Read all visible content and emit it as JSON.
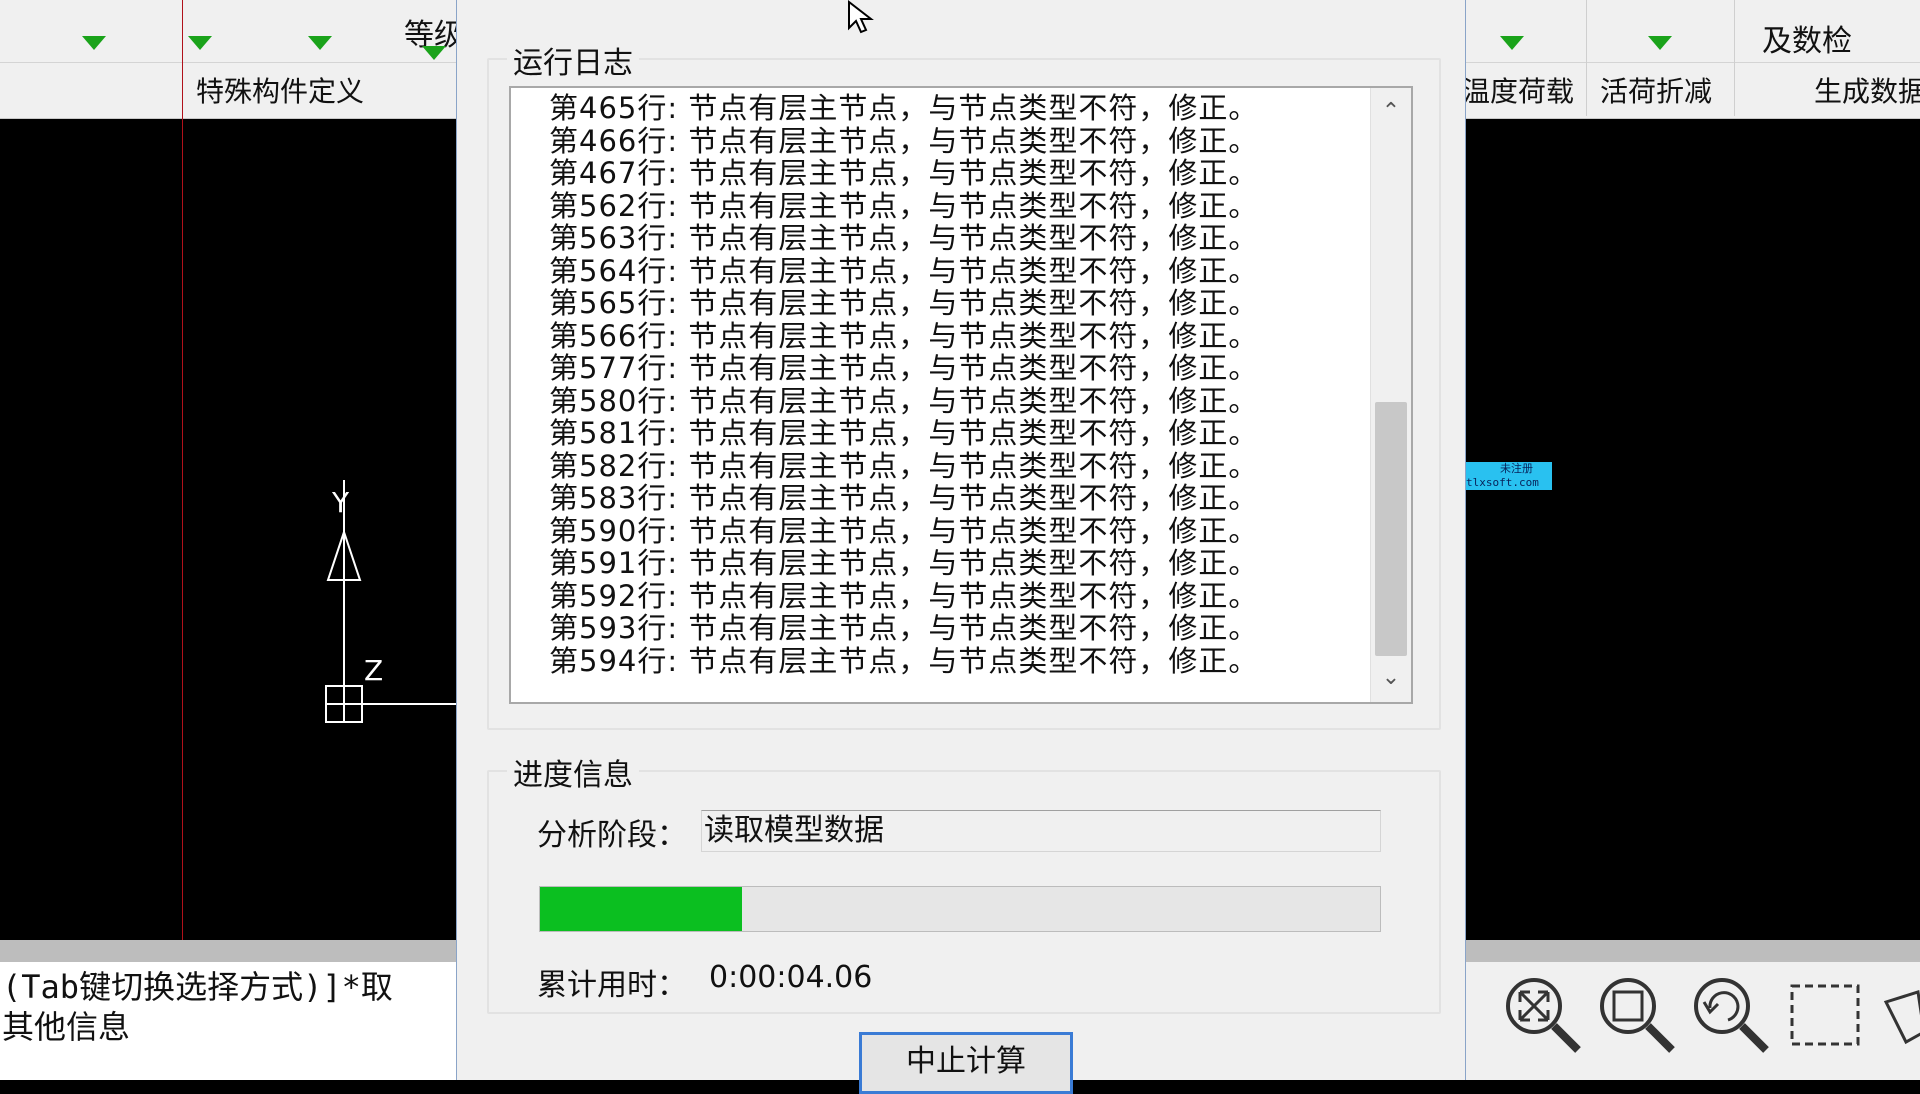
{
  "ribbon": {
    "left_button_partial": "等级",
    "left_group_label": "特殊构件定义",
    "right_group_label_1": "温度荷载",
    "right_group_label_2": "活荷折减",
    "right_button_top": "及数检",
    "right_group_label_3": "生成数据"
  },
  "dialog": {
    "log_title": "运行日志",
    "log_lines": [
      "第465行: 节点有层主节点，与节点类型不符，修正。",
      "第466行: 节点有层主节点，与节点类型不符，修正。",
      "第467行: 节点有层主节点，与节点类型不符，修正。",
      "第562行: 节点有层主节点，与节点类型不符，修正。",
      "第563行: 节点有层主节点，与节点类型不符，修正。",
      "第564行: 节点有层主节点，与节点类型不符，修正。",
      "第565行: 节点有层主节点，与节点类型不符，修正。",
      "第566行: 节点有层主节点，与节点类型不符，修正。",
      "第577行: 节点有层主节点，与节点类型不符，修正。",
      "第580行: 节点有层主节点，与节点类型不符，修正。",
      "第581行: 节点有层主节点，与节点类型不符，修正。",
      "第582行: 节点有层主节点，与节点类型不符，修正。",
      "第583行: 节点有层主节点，与节点类型不符，修正。",
      "第590行: 节点有层主节点，与节点类型不符，修正。",
      "第591行: 节点有层主节点，与节点类型不符，修正。",
      "第592行: 节点有层主节点，与节点类型不符，修正。",
      "第593行: 节点有层主节点，与节点类型不符，修正。",
      "第594行: 节点有层主节点，与节点类型不符，修正。"
    ],
    "progress_title": "进度信息",
    "stage_label": "分析阶段：",
    "stage_value": "读取模型数据",
    "progress_percent": 24,
    "elapsed_label": "累计用时：",
    "elapsed_value": "0:00:04.06",
    "abort_button": "中止计算"
  },
  "canvas": {
    "axis_y_label": "Y",
    "axis_z_label": "Z"
  },
  "command": {
    "line1": "(Tab键切换选择方式)]*取",
    "line2": "其他信息"
  },
  "badge": {
    "line1": "未注册",
    "line2": "tlxsoft.com"
  },
  "colors": {
    "progress_fill": "#0bbf20",
    "ribbon_arrow": "#1aa31a",
    "focus_border": "#3a7bd5"
  },
  "icons": {
    "zoom_extents": "zoom-extents-icon",
    "zoom_window": "zoom-window-icon",
    "zoom_previous": "zoom-previous-icon",
    "select_window": "select-window-icon",
    "pan": "pan-icon"
  }
}
